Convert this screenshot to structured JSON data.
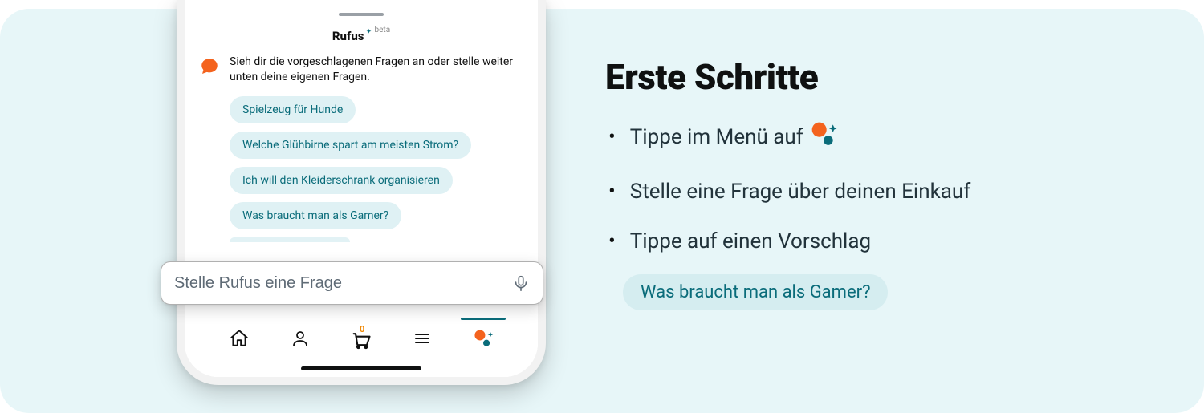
{
  "phone": {
    "title": "Rufus",
    "badge": "beta",
    "intro": "Sieh dir die vorgeschlagenen Fragen an oder stelle weiter unten deine eigenen Fragen.",
    "chips": [
      "Spielzeug für Hunde",
      "Welche Glühbirne spart am meisten Strom?",
      "Ich will den Kleiderschrank organisieren",
      "Was braucht man als Gamer?"
    ],
    "input_placeholder": "Stelle Rufus eine Frage",
    "cart_count": "0"
  },
  "right": {
    "headline": "Erste Schritte",
    "bullets": [
      "Tippe im Menü auf",
      "Stelle eine Frage über deinen Einkauf",
      "Tippe auf einen Vorschlag"
    ],
    "example_pill": "Was braucht man als Gamer?"
  },
  "colors": {
    "orange": "#f4631e",
    "teal": "#0a6c7a"
  }
}
